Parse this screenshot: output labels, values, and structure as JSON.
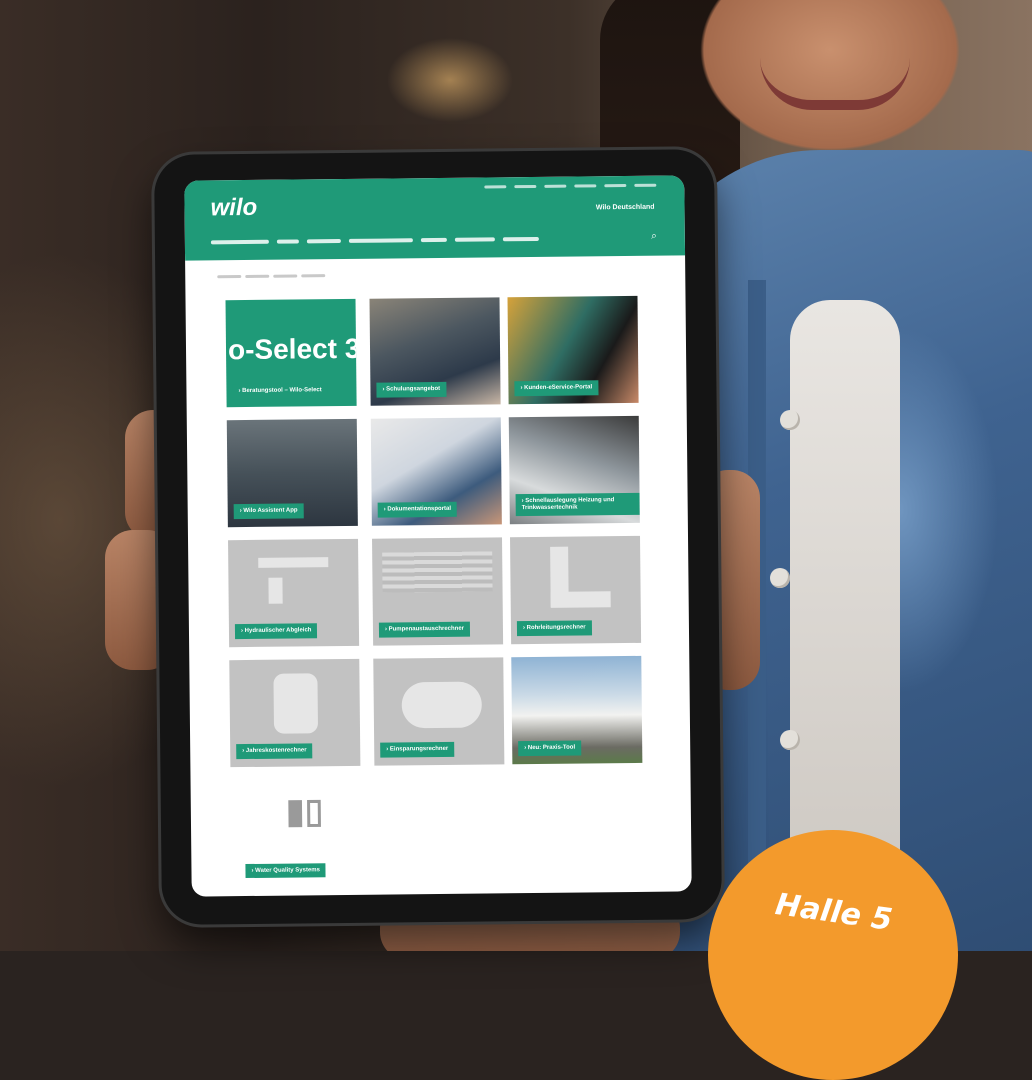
{
  "site": {
    "logo": "wilo",
    "country": "Wilo Deutschland",
    "search_icon": "search-icon"
  },
  "hero_tile": {
    "big_text": "o-Select 3",
    "label": "› Beratungstool – Wilo-Select"
  },
  "tiles": [
    {
      "label": "› Schulungsangebot"
    },
    {
      "label": "› Kunden-eService-Portal"
    },
    {
      "label": "› Wilo Assistent App"
    },
    {
      "label": "› Dokumentationsportal"
    },
    {
      "label": "› Schnellauslegung Heizung und Trinkwassertechnik"
    },
    {
      "label": "› Hydraulischer Abgleich"
    },
    {
      "label": "› Pumpenaustauschrechner"
    },
    {
      "label": "› Rohrleitungsrechner"
    },
    {
      "label": "› Jahreskostenrechner"
    },
    {
      "label": "› Einsparungsrechner"
    },
    {
      "label": "› Neu: Praxis-Tool"
    },
    {
      "label": "› Water Quality Systems"
    }
  ],
  "wqs_icon_text": "wilo",
  "badge": {
    "text": "Halle 5"
  },
  "colors": {
    "brand_green": "#1f9a78",
    "badge_orange": "#f39a2c"
  }
}
